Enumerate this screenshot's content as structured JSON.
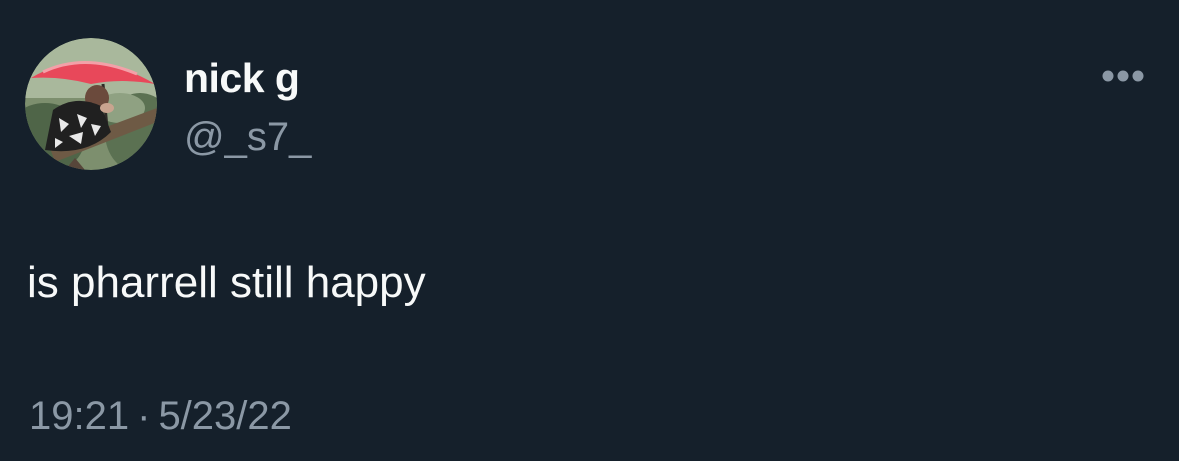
{
  "tweet": {
    "author": {
      "display_name": "nick g",
      "handle": "@_s7_"
    },
    "text": "is pharrell still happy",
    "time": "19:21",
    "separator": "·",
    "date": "5/23/22",
    "more_icon": "more-horizontal-icon"
  },
  "colors": {
    "background": "#15202b",
    "primary_text": "#f7f9f9",
    "secondary_text": "#8b98a5",
    "umbrella": "#e8485a"
  }
}
